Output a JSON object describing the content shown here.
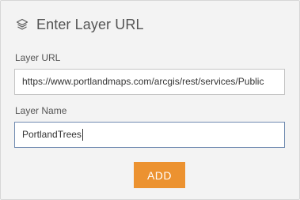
{
  "header": {
    "icon": "layers-icon",
    "title": "Enter Layer URL"
  },
  "layer_url": {
    "label": "Layer URL",
    "value": "https://www.portlandmaps.com/arcgis/rest/services/Public"
  },
  "layer_name": {
    "label": "Layer Name",
    "value": "PortlandTrees"
  },
  "actions": {
    "add_label": "ADD"
  },
  "colors": {
    "panel_background": "#f3f3f3",
    "add_button": "#ec9230",
    "focused_border": "#6f8ab0"
  }
}
